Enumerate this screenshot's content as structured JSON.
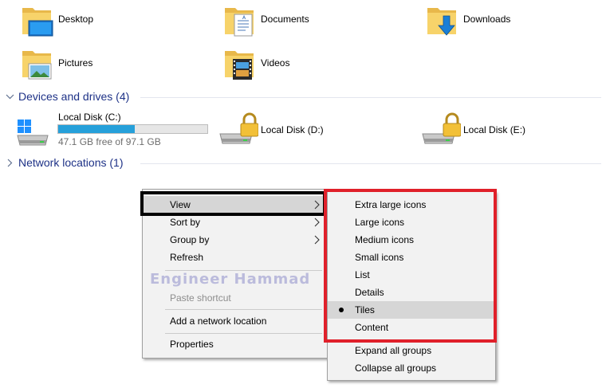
{
  "folders": [
    {
      "label": "Desktop",
      "icon": "desktop-folder-icon"
    },
    {
      "label": "Documents",
      "icon": "documents-folder-icon"
    },
    {
      "label": "Downloads",
      "icon": "downloads-folder-icon"
    },
    {
      "label": "Pictures",
      "icon": "pictures-folder-icon"
    },
    {
      "label": "Videos",
      "icon": "videos-folder-icon"
    }
  ],
  "devices": {
    "header": "Devices and drives (4)",
    "drives": [
      {
        "label": "Local Disk (C:)",
        "free_text": "47.1 GB free of 97.1 GB",
        "used_fraction": 0.515,
        "icon": "windows-drive-icon"
      },
      {
        "label": "Local Disk (D:)",
        "icon": "locked-drive-icon"
      },
      {
        "label": "Local Disk (E:)",
        "icon": "locked-drive-icon"
      }
    ]
  },
  "network": {
    "header": "Network locations (1)"
  },
  "context_menu": {
    "items": [
      {
        "label": "View",
        "has_submenu": true
      },
      {
        "label": "Sort by",
        "has_submenu": true
      },
      {
        "label": "Group by",
        "has_submenu": true
      },
      {
        "label": "Refresh"
      },
      {
        "label": "Paste shortcut",
        "disabled": true
      },
      {
        "label": "Add a network location"
      },
      {
        "label": "Properties"
      }
    ]
  },
  "view_submenu": {
    "items": [
      {
        "label": "Extra large icons"
      },
      {
        "label": "Large icons"
      },
      {
        "label": "Medium icons"
      },
      {
        "label": "Small icons"
      },
      {
        "label": "List"
      },
      {
        "label": "Details"
      },
      {
        "label": "Tiles",
        "selected": true
      },
      {
        "label": "Content"
      },
      {
        "label": "Expand all groups"
      },
      {
        "label": "Collapse all groups"
      }
    ]
  },
  "watermark": "Engineer Hammad",
  "colors": {
    "accent": "#26a0da",
    "header_text": "#1e3287",
    "highlight_red": "#e0202a",
    "highlight_black": "#000000"
  }
}
